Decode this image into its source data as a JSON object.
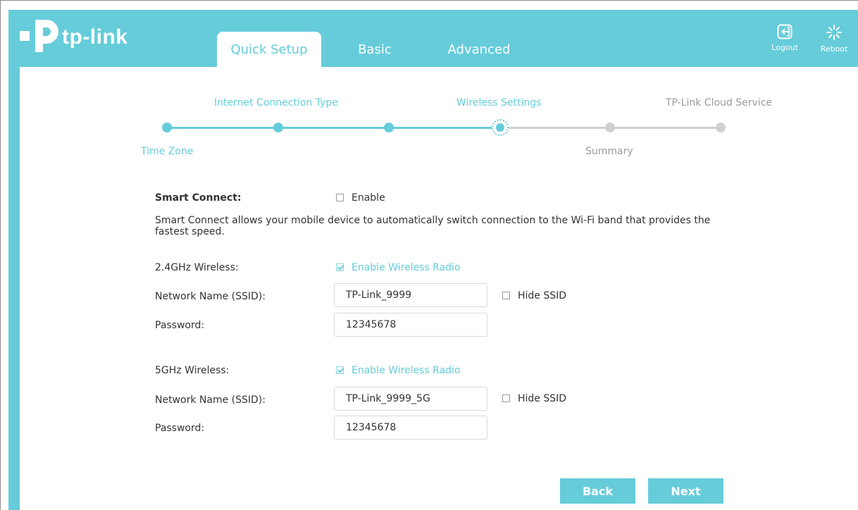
{
  "brand": {
    "logo_text": "tp-link",
    "accent": "#66ccda"
  },
  "header": {
    "tabs": [
      {
        "label": "Quick Setup",
        "active": true
      },
      {
        "label": "Basic",
        "active": false
      },
      {
        "label": "Advanced",
        "active": false
      }
    ],
    "logout_label": "Logout",
    "reboot_label": "Reboot"
  },
  "wizard": {
    "steps": [
      {
        "label": "Time Zone",
        "state": "done"
      },
      {
        "label": "Internet Connection Type",
        "state": "done"
      },
      {
        "label": "",
        "state": "done"
      },
      {
        "label": "Wireless Settings",
        "state": "current"
      },
      {
        "label": "Summary",
        "state": "todo"
      },
      {
        "label": "TP-Link Cloud Service",
        "state": "todo"
      }
    ]
  },
  "smart_connect": {
    "label": "Smart Connect:",
    "enable_label": "Enable",
    "enabled": false,
    "description": "Smart Connect allows your mobile device to automatically switch connection to the Wi-Fi band that provides the fastest speed."
  },
  "band_24": {
    "label": "2.4GHz Wireless:",
    "radio_label": "Enable Wireless Radio",
    "radio_enabled": true,
    "ssid_label": "Network Name (SSID):",
    "ssid_value": "TP-Link_9999",
    "hide_ssid_label": "Hide SSID",
    "hide_ssid": false,
    "password_label": "Password:",
    "password_value": "12345678"
  },
  "band_5": {
    "label": "5GHz Wireless:",
    "radio_label": "Enable Wireless Radio",
    "radio_enabled": true,
    "ssid_label": "Network Name (SSID):",
    "ssid_value": "TP-Link_9999_5G",
    "hide_ssid_label": "Hide SSID",
    "hide_ssid": false,
    "password_label": "Password:",
    "password_value": "12345678"
  },
  "buttons": {
    "back_label": "Back",
    "next_label": "Next"
  }
}
